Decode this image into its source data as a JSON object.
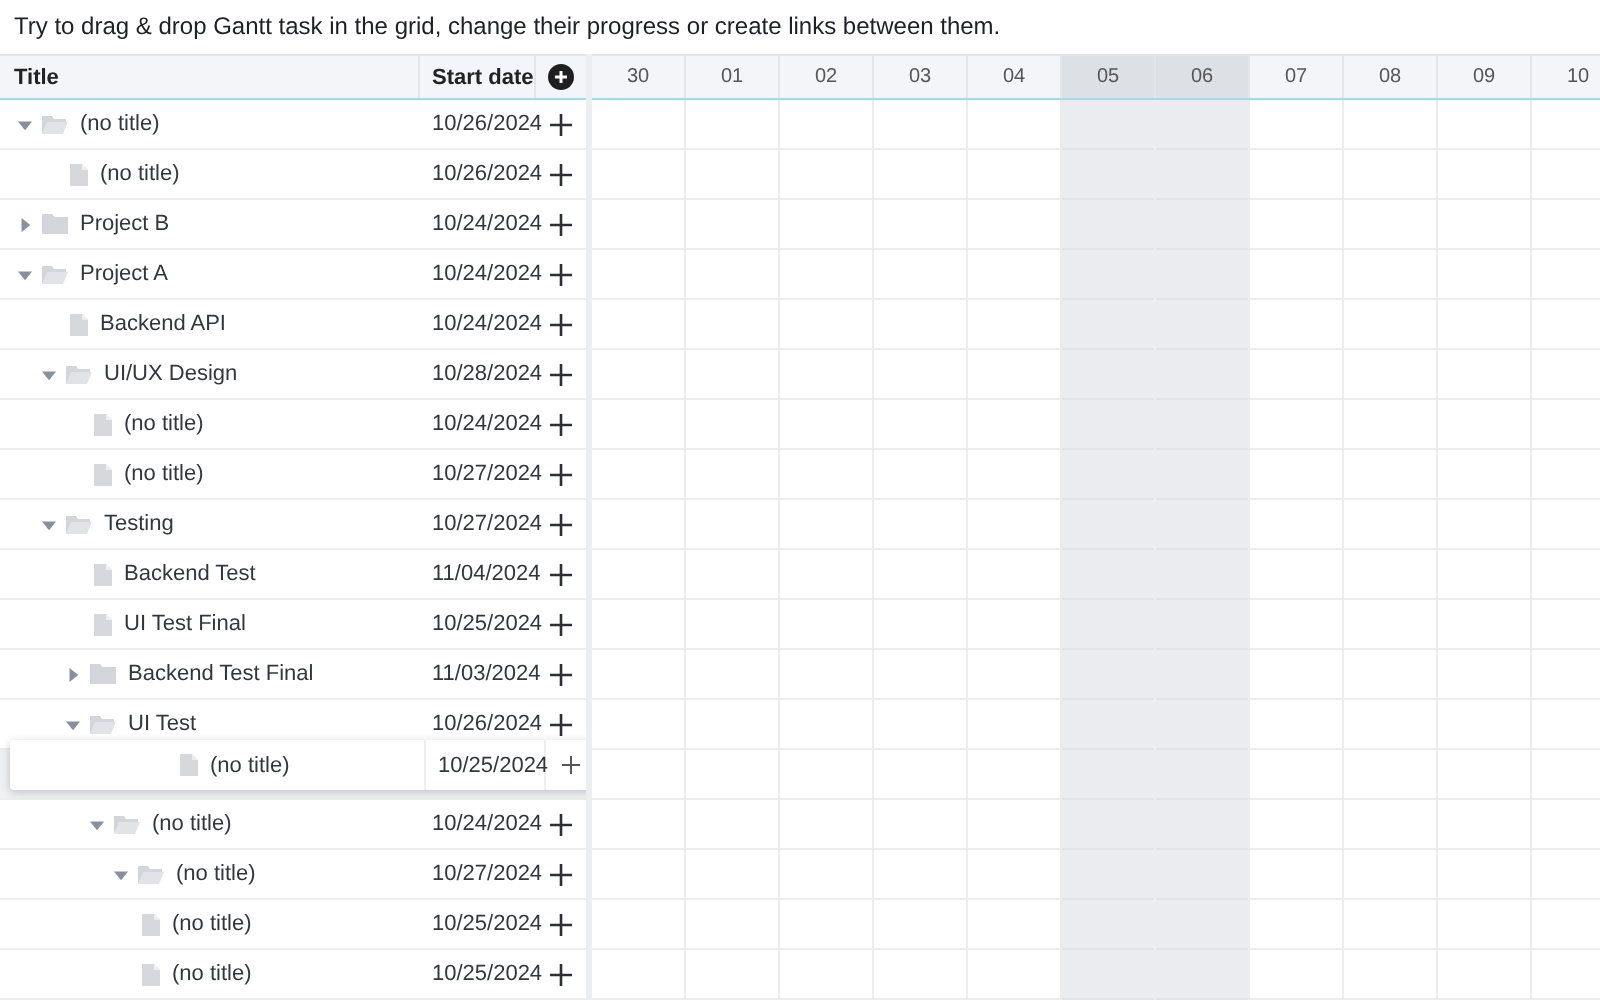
{
  "hint": "Try to drag & drop Gantt task in the grid, change their progress or create links between them.",
  "columns": [
    {
      "label": "Title"
    },
    {
      "label": "Start date"
    }
  ],
  "timeline": [
    {
      "label": "30",
      "weekend": false
    },
    {
      "label": "01",
      "weekend": false
    },
    {
      "label": "02",
      "weekend": false
    },
    {
      "label": "03",
      "weekend": false
    },
    {
      "label": "04",
      "weekend": false
    },
    {
      "label": "05",
      "weekend": true
    },
    {
      "label": "06",
      "weekend": true
    },
    {
      "label": "07",
      "weekend": false
    },
    {
      "label": "08",
      "weekend": false
    },
    {
      "label": "09",
      "weekend": false
    },
    {
      "label": "10",
      "weekend": false
    }
  ],
  "tasks": [
    {
      "kind": "folder",
      "title": "(no title)",
      "start_date": "10/26/2024",
      "expanded": true,
      "children": [
        {
          "kind": "file",
          "title": "(no title)",
          "start_date": "10/26/2024"
        }
      ]
    },
    {
      "kind": "folder",
      "title": "Project B",
      "start_date": "10/24/2024",
      "expanded": false
    },
    {
      "kind": "folder",
      "title": "Project A",
      "start_date": "10/24/2024",
      "expanded": true,
      "children": [
        {
          "kind": "file",
          "title": "Backend API",
          "start_date": "10/24/2024"
        },
        {
          "kind": "folder",
          "title": "UI/UX Design",
          "start_date": "10/28/2024",
          "expanded": true,
          "children": [
            {
              "kind": "file",
              "title": "(no title)",
              "start_date": "10/24/2024"
            },
            {
              "kind": "file",
              "title": "(no title)",
              "start_date": "10/27/2024"
            }
          ]
        },
        {
          "kind": "folder",
          "title": "Testing",
          "start_date": "10/27/2024",
          "expanded": true,
          "children": [
            {
              "kind": "file",
              "title": "Backend Test",
              "start_date": "11/04/2024"
            },
            {
              "kind": "file",
              "title": "UI Test Final",
              "start_date": "10/25/2024"
            },
            {
              "kind": "folder",
              "title": "Backend Test Final",
              "start_date": "11/03/2024",
              "expanded": false
            },
            {
              "kind": "folder",
              "title": "UI Test",
              "start_date": "10/26/2024",
              "expanded": true,
              "children": [
                {
                  "kind": "drop_placeholder"
                },
                {
                  "kind": "folder",
                  "title": "(no title)",
                  "start_date": "10/24/2024",
                  "expanded": true,
                  "children": [
                    {
                      "kind": "folder",
                      "title": "(no title)",
                      "start_date": "10/27/2024",
                      "expanded": true
                    },
                    {
                      "kind": "file",
                      "title": "(no title)",
                      "start_date": "10/25/2024"
                    },
                    {
                      "kind": "file",
                      "title": "(no title)",
                      "start_date": "10/25/2024"
                    }
                  ]
                }
              ]
            }
          ]
        }
      ]
    }
  ],
  "dragged_task": {
    "kind": "file",
    "title": "(no title)",
    "start_date": "10/25/2024"
  }
}
